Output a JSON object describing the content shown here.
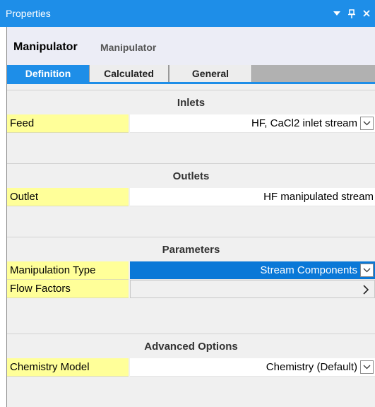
{
  "panel": {
    "title": "Properties",
    "controls": [
      "dropdown-icon",
      "pin-icon",
      "close-icon"
    ]
  },
  "header": {
    "object_name": "Manipulator",
    "object_type": "Manipulator"
  },
  "tabs": [
    {
      "label": "Definition",
      "active": true
    },
    {
      "label": "Calculated",
      "active": false
    },
    {
      "label": "General",
      "active": false
    }
  ],
  "sections": {
    "inlets": {
      "title": "Inlets",
      "rows": [
        {
          "label": "Feed",
          "value": "HF, CaCl2 inlet stream",
          "control": "dropdown"
        }
      ]
    },
    "outlets": {
      "title": "Outlets",
      "rows": [
        {
          "label": "Outlet",
          "value": "HF manipulated stream"
        }
      ]
    },
    "parameters": {
      "title": "Parameters",
      "rows": [
        {
          "label": "Manipulation Type",
          "value": "Stream Components",
          "control": "dropdown",
          "selected": true
        },
        {
          "label": "Flow Factors",
          "value": "",
          "control": "expand-arrow"
        }
      ]
    },
    "advanced": {
      "title": "Advanced Options",
      "rows": [
        {
          "label": "Chemistry Model",
          "value": "Chemistry (Default)",
          "control": "dropdown"
        }
      ]
    }
  },
  "colors": {
    "accent": "#1e8ee8",
    "selection": "#0a78d7",
    "label_bg": "#ffff99",
    "header_bg": "#ecedf6"
  }
}
